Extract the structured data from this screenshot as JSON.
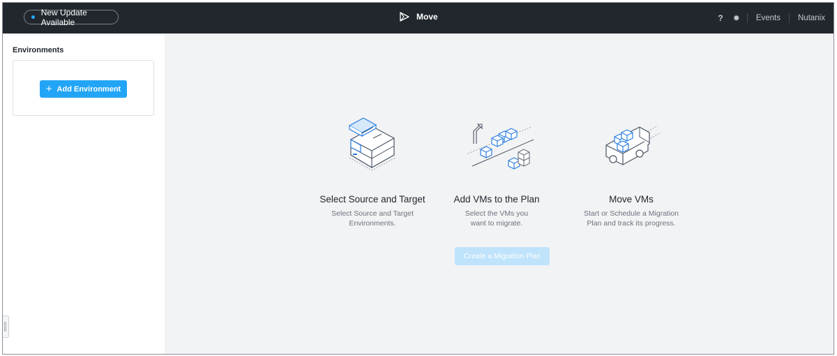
{
  "topbar": {
    "update_label": "New Update Available",
    "app_name": "Move",
    "help_label": "?",
    "events_label": "Events",
    "account_label": "Nutanix"
  },
  "sidebar": {
    "title": "Environments",
    "add_button_label": "Add Environment"
  },
  "steps": [
    {
      "title": "Select Source and Target",
      "description_line1": "Select Source and Target",
      "description_line2": "Environments.",
      "icon": "server-stack-icon"
    },
    {
      "title": "Add VMs to the Plan",
      "description_line1": "Select the VMs you",
      "description_line2": "want to migrate.",
      "icon": "vm-boxes-conveyor-icon"
    },
    {
      "title": "Move VMs",
      "description_line1": "Start or Schedule a Migration",
      "description_line2": "Plan and track its progress.",
      "icon": "truck-icon"
    }
  ],
  "create_button_label": "Create a Migration Plan",
  "colors": {
    "topbar": "#22272e",
    "accent": "#22a5f7",
    "main_bg": "#f2f3f5",
    "disabled_button": "#bfe3fb"
  }
}
